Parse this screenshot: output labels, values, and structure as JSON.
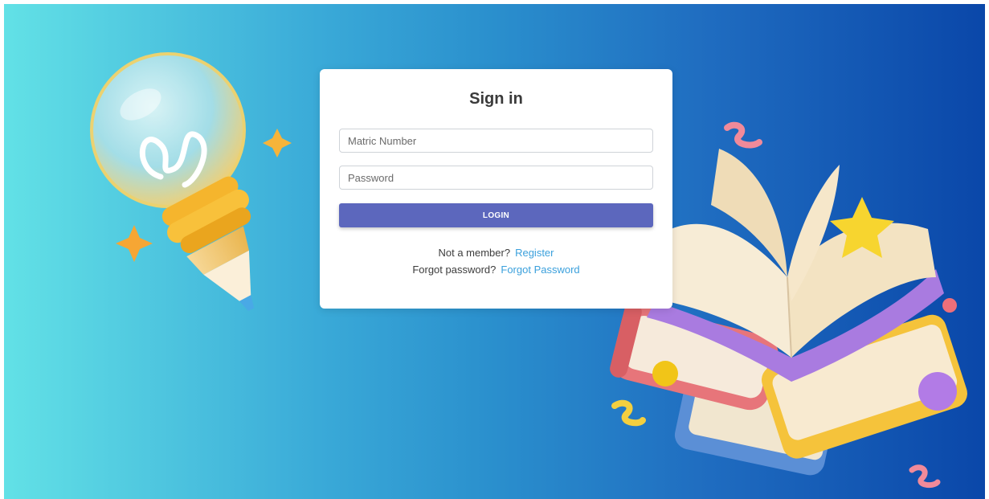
{
  "login_form": {
    "title": "Sign in",
    "matric_placeholder": "Matric Number",
    "password_placeholder": "Password",
    "login_label": "LOGIN",
    "register_prompt": "Not a member?",
    "register_link": "Register",
    "forgot_prompt": "Forgot password?",
    "forgot_link": "Forgot Password"
  },
  "colors": {
    "background_start": "#62e1e6",
    "background_end": "#0a47a9",
    "button": "#5c67bd",
    "link": "#3ba0dc"
  },
  "illustrations": {
    "left": "lightbulb-pencil-illustration",
    "right": "open-books-illustration"
  }
}
